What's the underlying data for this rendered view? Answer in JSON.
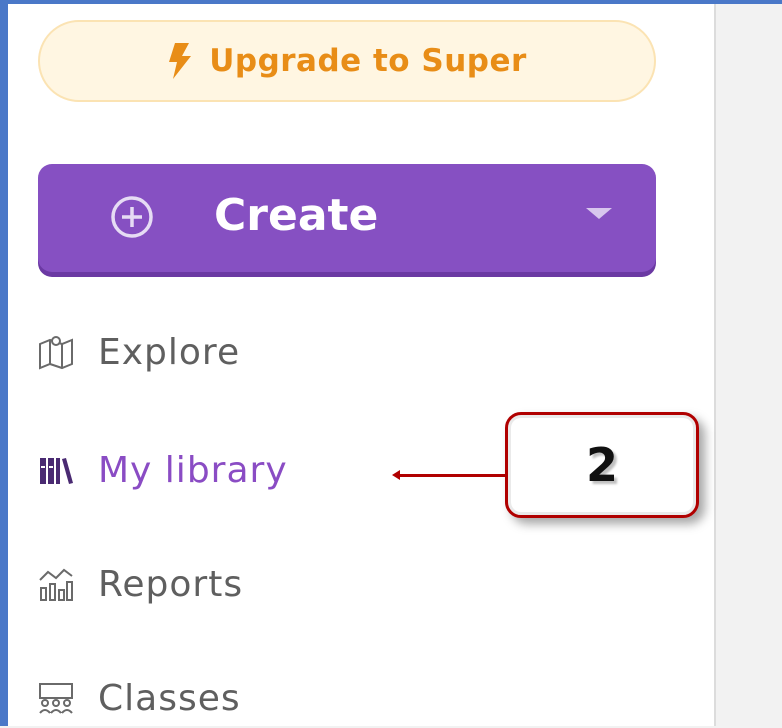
{
  "sidebar": {
    "upgrade": {
      "label": "Upgrade to Super",
      "icon": "lightning-bolt-icon",
      "color": "#e88d17"
    },
    "create": {
      "label": "Create",
      "icon": "plus-circle-icon",
      "dropdown_icon": "caret-down-icon",
      "color": "#8650c2"
    },
    "nav": [
      {
        "label": "Explore",
        "icon": "map-icon",
        "active": false
      },
      {
        "label": "My library",
        "icon": "library-icon",
        "active": true
      },
      {
        "label": "Reports",
        "icon": "reports-chart-icon",
        "active": false
      },
      {
        "label": "Classes",
        "icon": "classes-group-icon",
        "active": false
      }
    ]
  },
  "annotation": {
    "label": "2",
    "color": "#b00000"
  }
}
